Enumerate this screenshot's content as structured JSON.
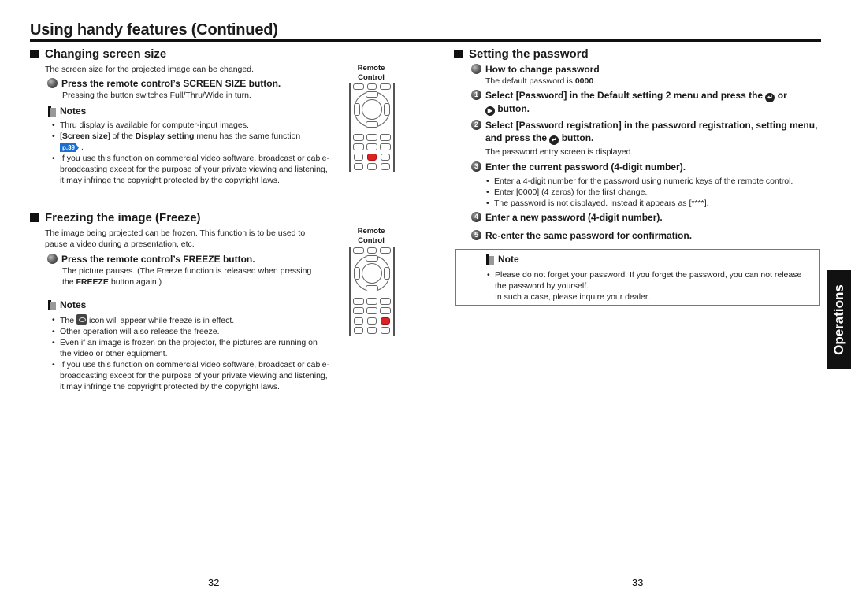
{
  "header": {
    "title": "Using handy features (Continued)"
  },
  "left": {
    "screen_size": {
      "heading": "Changing screen size",
      "intro": "The screen size for the projected image can be changed.",
      "step": "Press the remote control’s SCREEN SIZE button.",
      "step_detail": "Pressing the button switches Full/Thru/Wide in turn.",
      "notes_heading": "Notes",
      "notes": [
        "Thru display is available for computer-input images.",
        "If you use this function on commercial video software, broadcast or cable-broadcasting except for the purpose of your private viewing and listening, it may infringe the copyright protected by the copyright laws."
      ],
      "note2": {
        "pre": "[",
        "bold1": "Screen size",
        "mid": "] of the ",
        "bold2": "Display setting",
        "post": " menu has the same function",
        "page_ref": "p.39",
        "end": "."
      },
      "remote_label_1": "Remote",
      "remote_label_2": "Control"
    },
    "freeze": {
      "heading": "Freezing the image (Freeze)",
      "intro": "The image being projected can be frozen. This function is to be used to pause a video during a presentation, etc.",
      "step": "Press the remote control’s FREEZE button.",
      "step_detail_pre": "The picture pauses. (The Freeze function is released when pressing the ",
      "step_detail_bold": "FREEZE",
      "step_detail_post": " button again.)",
      "notes_heading": "Notes",
      "note1_pre": "The",
      "note1_post": "icon will appear while freeze is in effect.",
      "notes": [
        "Other operation will also release the freeze.",
        "Even if an image is frozen on the projector, the pictures are running on the video or other equipment.",
        "If you use this function on commercial video software, broadcast or cable-broadcasting except for the purpose of your private viewing and listening, it may infringe the copyright protected by the copyright laws."
      ],
      "remote_label_1": "Remote",
      "remote_label_2": "Control"
    },
    "page_number": "32"
  },
  "right": {
    "password": {
      "heading": "Setting the password",
      "how_to": "How to change password",
      "default_pre": "The default password is ",
      "default_value": "0000",
      "default_post": ".",
      "steps": [
        {
          "num": "1",
          "text_a": "Select [Password] in the Default setting 2 menu and press the",
          "text_b": "or",
          "text_c": "button."
        },
        {
          "num": "2",
          "text_a": "Select [Password registration] in the password registration, setting menu, and press the",
          "text_b": "button."
        },
        {
          "num": "3",
          "text": "Enter the current password (4-digit number)."
        },
        {
          "num": "4",
          "text": "Enter a new password (4-digit number)."
        },
        {
          "num": "5",
          "text": "Re-enter the same password for confirmation."
        }
      ],
      "step2_detail": "The password entry screen is displayed.",
      "step3_bullets": [
        "Enter a 4-digit number for the password using numeric keys of the remote control.",
        "Enter [0000] (4 zeros) for the first change.",
        "The password is not displayed. Instead it appears as [****]."
      ],
      "note_heading": "Note",
      "note_text": "Please do not forget your password. If you forget the password, you can not release the password by yourself.",
      "note_text_2": "In such a case, please inquire your dealer."
    },
    "side_tab": "Operations",
    "page_number": "33"
  },
  "icons": {
    "enter": "↵",
    "right": "▶"
  }
}
